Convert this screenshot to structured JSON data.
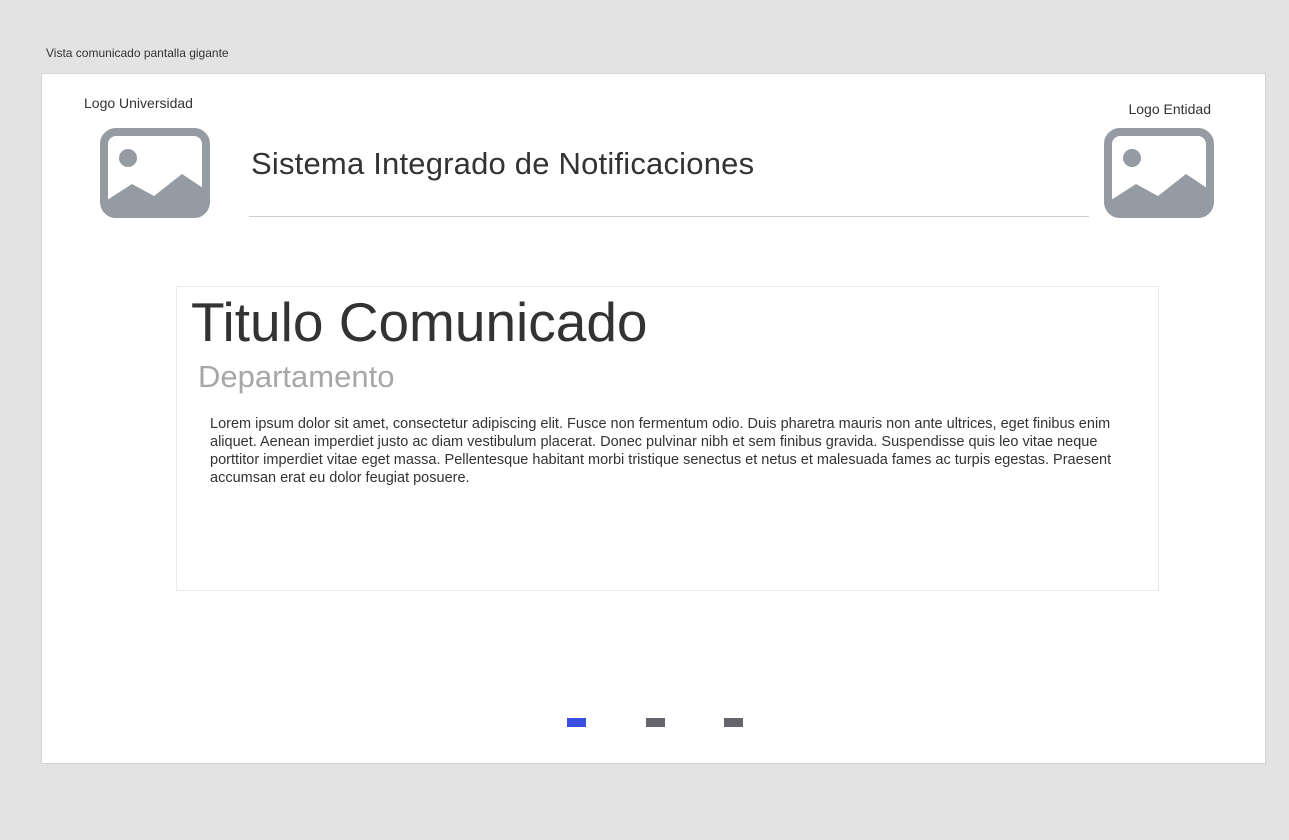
{
  "frame": {
    "caption": "Vista comunicado pantalla gigante"
  },
  "header": {
    "logo_left_label": "Logo Universidad",
    "logo_right_label": "Logo Entidad",
    "title": "Sistema Integrado de Notificaciones",
    "logo_icon": "image-placeholder-icon"
  },
  "notice": {
    "title": "Titulo Comunicado",
    "department": "Departamento",
    "body": "Lorem ipsum dolor sit amet, consectetur adipiscing elit. Fusce non fermentum odio. Duis pharetra mauris non ante ultrices, eget finibus enim aliquet. Aenean imperdiet justo ac diam vestibulum placerat. Donec pulvinar nibh et sem finibus gravida. Suspendisse quis leo vitae neque porttitor imperdiet vitae eget massa. Pellentesque habitant morbi tristique senectus et netus et malesuada fames ac turpis egestas. Praesent accumsan erat eu dolor feugiat posuere."
  },
  "carousel": {
    "active_index": 0,
    "count": 3
  },
  "colors": {
    "background": "#e3e3e3",
    "placeholder_gray": "#959ba3",
    "indicator_active": "#3a4ee0",
    "indicator_inactive": "#66656c",
    "department_text": "#a7a7a7"
  }
}
